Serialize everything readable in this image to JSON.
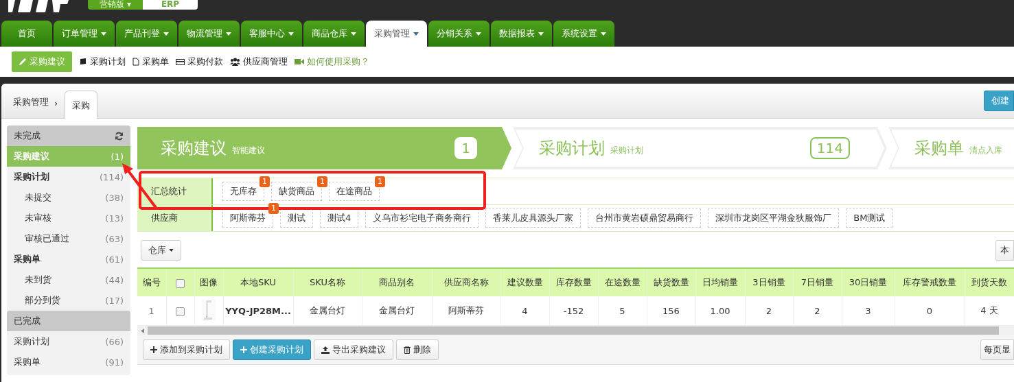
{
  "header": {
    "edition": "营销版",
    "caret": "▾",
    "product": "ERP"
  },
  "nav_tabs": [
    {
      "label": "首页",
      "dropdown": false,
      "selected": false
    },
    {
      "label": "订单管理",
      "dropdown": true,
      "selected": false
    },
    {
      "label": "产品刊登",
      "dropdown": true,
      "selected": false
    },
    {
      "label": "物流管理",
      "dropdown": true,
      "selected": false
    },
    {
      "label": "客服中心",
      "dropdown": true,
      "selected": false
    },
    {
      "label": "商品仓库",
      "dropdown": true,
      "selected": false
    },
    {
      "label": "采购管理",
      "dropdown": true,
      "selected": true
    },
    {
      "label": "分销关系",
      "dropdown": true,
      "selected": false
    },
    {
      "label": "数据报表",
      "dropdown": true,
      "selected": false
    },
    {
      "label": "系统设置",
      "dropdown": true,
      "selected": false
    }
  ],
  "sub_nav": [
    {
      "label": "采购建议",
      "kind": "item",
      "selected": true
    },
    {
      "label": "采购计划",
      "kind": "item",
      "selected": false
    },
    {
      "label": "采购单",
      "kind": "item",
      "selected": false
    },
    {
      "label": "采购付款",
      "kind": "item",
      "selected": false
    },
    {
      "label": "供应商管理",
      "kind": "item",
      "selected": false
    },
    {
      "label": "如何使用采购？",
      "kind": "help",
      "selected": false
    }
  ],
  "breadcrumb": {
    "parent": "采购管理",
    "separator": "›",
    "tab": "采购"
  },
  "create_button": "创建",
  "sidebar": [
    {
      "title": "未完成",
      "refresh": true,
      "items": [
        {
          "label": "采购建议",
          "count": "(1)",
          "bold": true,
          "selected": true
        },
        {
          "label": "采购计划",
          "count": "(114)",
          "bold": true,
          "selected": false,
          "children": [
            {
              "label": "未提交",
              "count": "(38)",
              "selected": false
            },
            {
              "label": "未审核",
              "count": "(13)",
              "selected": false
            },
            {
              "label": "审核已通过",
              "count": "(63)",
              "selected": false
            }
          ]
        },
        {
          "label": "采购单",
          "count": "(61)",
          "bold": true,
          "selected": false,
          "children": [
            {
              "label": "未到货",
              "count": "(44)",
              "selected": false
            },
            {
              "label": "部分到货",
              "count": "(17)",
              "selected": false
            }
          ]
        }
      ]
    },
    {
      "title": "已完成",
      "refresh": false,
      "items": [
        {
          "label": "采购计划",
          "count": "(66)",
          "bold": false,
          "selected": false
        },
        {
          "label": "采购单",
          "count": "(91)",
          "bold": false,
          "selected": false
        }
      ]
    }
  ],
  "steps": [
    {
      "title": "采购建议",
      "subtitle": "智能建议",
      "count": "1",
      "selected": true
    },
    {
      "title": "采购计划",
      "subtitle": "采购计划",
      "count": "114",
      "selected": false
    },
    {
      "title": "采购单",
      "subtitle": "清点入库",
      "selected": false
    }
  ],
  "filters": [
    {
      "label": "汇总统计",
      "tags": [
        {
          "text": "无库存",
          "badge": "1"
        },
        {
          "text": "缺货商品",
          "badge": "1"
        },
        {
          "text": "在途商品",
          "badge": "1"
        }
      ]
    },
    {
      "label": "供应商",
      "tags": [
        {
          "text": "阿斯蒂芬",
          "badge": "1"
        },
        {
          "text": "测试"
        },
        {
          "text": "测试4"
        },
        {
          "text": "义乌市衫宅电子商务商行"
        },
        {
          "text": "香莱儿皮具源头厂家"
        },
        {
          "text": "台州市黄岩硕鼎贸易商行"
        },
        {
          "text": "深圳市龙岗区平湖金狄服饰厂"
        },
        {
          "text": "BM测试"
        }
      ]
    }
  ],
  "warehouse_button": "仓库",
  "right_button": "本",
  "table": {
    "columns": [
      "编号",
      {
        "kind": "checkbox",
        "checked": false
      },
      "图像",
      "本地SKU",
      "SKU名称",
      "商品别名",
      "供应商名称",
      "建议数量",
      "库存数量",
      "在途数量",
      "缺货数量",
      "日均销量",
      "3日销量",
      "7日销量",
      "30日销量",
      "库存警戒数量",
      "到货天数"
    ],
    "rows": [
      {
        "cells": [
          "1",
          {
            "kind": "checkbox",
            "checked": false
          },
          {
            "kind": "picture"
          },
          "YYQ-JP28M...",
          "金属台灯",
          "金属台灯",
          "阿斯蒂芬",
          "4",
          "-152",
          "5",
          "156",
          "1.00",
          "2",
          "2",
          "3",
          "0",
          "4 天"
        ]
      }
    ]
  },
  "actions": [
    {
      "label": "添加到采购计划",
      "kind": "default"
    },
    {
      "label": "创建采购计划",
      "kind": "primary"
    },
    {
      "label": "导出采购建议",
      "kind": "default"
    },
    {
      "label": "删除",
      "kind": "default"
    }
  ],
  "page_size_label": "每页显"
}
